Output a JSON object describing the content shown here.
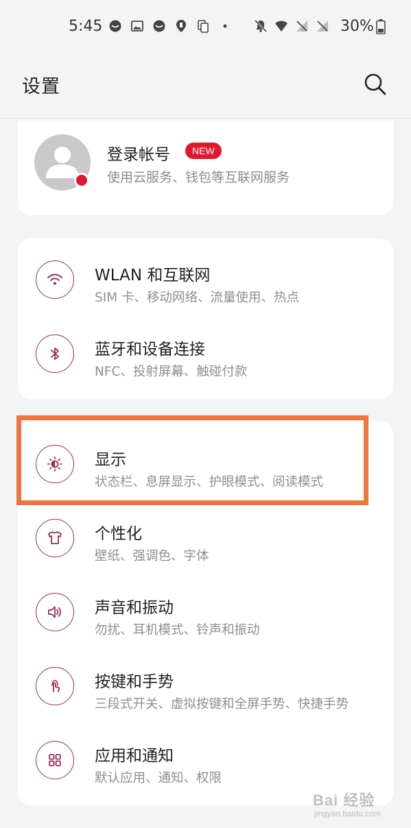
{
  "status_bar": {
    "time": "5:45",
    "battery": "30%",
    "left_icons": [
      "notification-dot-icon",
      "image-icon",
      "notification-dot-icon",
      "location-pin-icon",
      "copy-icon",
      "more-dot-icon"
    ],
    "right_icons": [
      "bell-mute-icon",
      "wifi-icon",
      "no-signal-icon",
      "no-signal-icon"
    ]
  },
  "header": {
    "title": "设置",
    "search_icon": "search-icon"
  },
  "account": {
    "title": "登录帐号",
    "badge": "NEW",
    "subtitle": "使用云服务、钱包等互联网服务",
    "badge_color": "#e0182f"
  },
  "network_group": [
    {
      "title": "WLAN 和互联网",
      "subtitle": "SIM 卡、移动网络、流量使用、热点",
      "icon": "wifi-icon"
    },
    {
      "title": "蓝牙和设备连接",
      "subtitle": "NFC、投射屏幕、触碰付款",
      "icon": "bluetooth-icon"
    }
  ],
  "main_group": [
    {
      "title": "显示",
      "subtitle": "状态栏、息屏显示、护眼模式、阅读模式",
      "icon": "brightness-icon"
    },
    {
      "title": "个性化",
      "subtitle": "壁纸、强调色、字体",
      "icon": "shirt-icon"
    },
    {
      "title": "声音和振动",
      "subtitle": "勿扰、耳机模式、铃声和振动",
      "icon": "speaker-icon"
    },
    {
      "title": "按键和手势",
      "subtitle": "三段式开关、虚拟按键和全屏手势、快捷手势",
      "icon": "gesture-icon"
    },
    {
      "title": "应用和通知",
      "subtitle": "默认应用、通知、权限",
      "icon": "apps-grid-icon"
    }
  ],
  "accent_color": "#9e2a55",
  "highlight_color": "#f0743e",
  "watermark": {
    "main": "Bai 经验",
    "sub": "jingyan.baidu.com"
  }
}
